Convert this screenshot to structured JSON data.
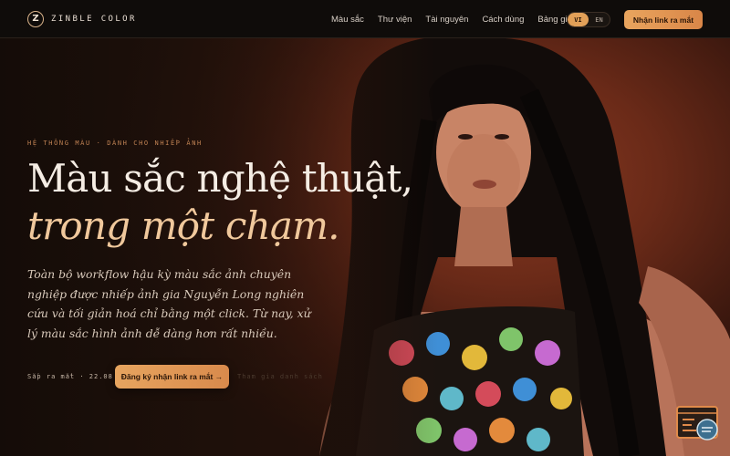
{
  "brand": {
    "mark": "Z",
    "name": "ZINBLE COLOR"
  },
  "nav": {
    "items": [
      "Màu sắc",
      "Thư viện",
      "Tài nguyên",
      "Cách dùng",
      "Bảng giá"
    ],
    "languages": [
      "VI",
      "EN"
    ],
    "active_language": "VI",
    "cta": "Nhận link ra mắt"
  },
  "hero": {
    "eyebrow": "HỆ THỐNG MÀU · DÀNH CHO NHIẾP ẢNH",
    "headline_line1": "Màu sắc nghệ thuật,",
    "headline_line2": "trong một chạm.",
    "subcopy": "Toàn bộ workflow hậu kỳ màu sắc ảnh chuyên nghiệp được nhiếp ảnh gia Nguyễn Long nghiên cứu và tối giản hoá chỉ bằng một click. Từ nay, xử lý màu sắc hình ảnh dễ dàng hơn rất nhiều.",
    "launch_date": "Sắp ra mắt · 22.08",
    "cta": "Đăng ký nhận link ra mắt →",
    "secondary_link": "Tham gia danh sách"
  },
  "icons": {
    "chat": "chat-widget-icon",
    "logo": "logo-mark-icon"
  },
  "colors": {
    "accent": "#e2a058",
    "background": "#130d09",
    "hero_warm": "#8a3a22"
  }
}
